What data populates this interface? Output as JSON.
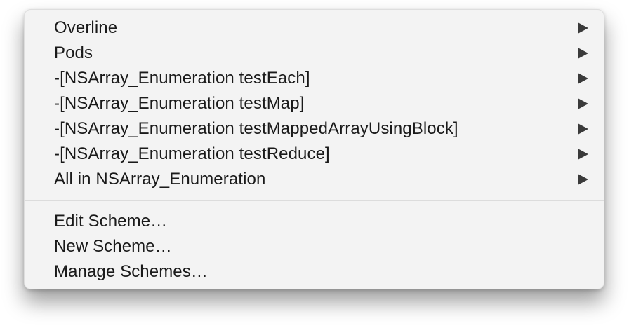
{
  "menu": {
    "submenu_items": [
      {
        "label": "Overline"
      },
      {
        "label": "Pods"
      },
      {
        "label": "-[NSArray_Enumeration testEach]"
      },
      {
        "label": "-[NSArray_Enumeration testMap]"
      },
      {
        "label": "-[NSArray_Enumeration testMappedArrayUsingBlock]"
      },
      {
        "label": "-[NSArray_Enumeration testReduce]"
      },
      {
        "label": "All in NSArray_Enumeration"
      }
    ],
    "action_items": [
      {
        "label": "Edit Scheme…"
      },
      {
        "label": "New Scheme…"
      },
      {
        "label": "Manage Schemes…"
      }
    ]
  },
  "icons": {
    "submenu_arrow": "chevron-right-icon"
  }
}
